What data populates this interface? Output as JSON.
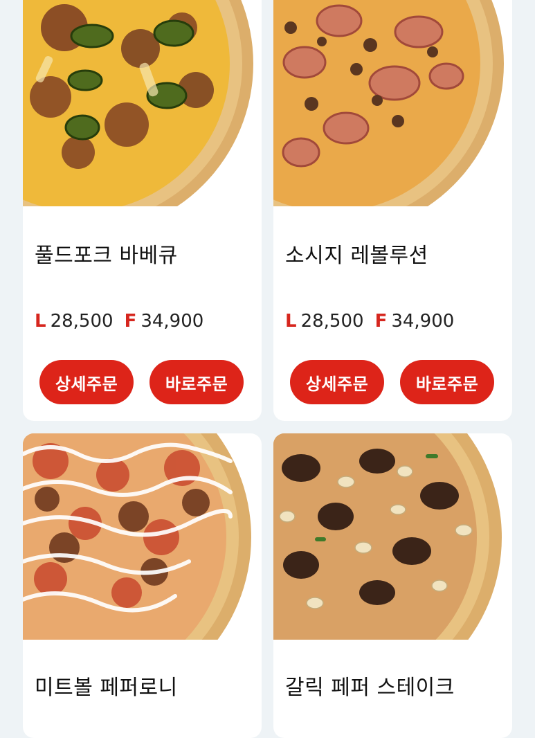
{
  "menu": [
    {
      "name": "풀드포크 바베큐",
      "price_l_label": "L",
      "price_l": "28,500",
      "price_f_label": "F",
      "price_f": "34,900",
      "detail_label": "상세주문",
      "direct_label": "바로주문"
    },
    {
      "name": "소시지 레볼루션",
      "price_l_label": "L",
      "price_l": "28,500",
      "price_f_label": "F",
      "price_f": "34,900",
      "detail_label": "상세주문",
      "direct_label": "바로주문"
    },
    {
      "name": "미트볼 페퍼로니"
    },
    {
      "name": "갈릭 페퍼 스테이크"
    }
  ],
  "colors": {
    "accent": "#dd2419",
    "background": "#eef3f6",
    "card": "#ffffff"
  }
}
